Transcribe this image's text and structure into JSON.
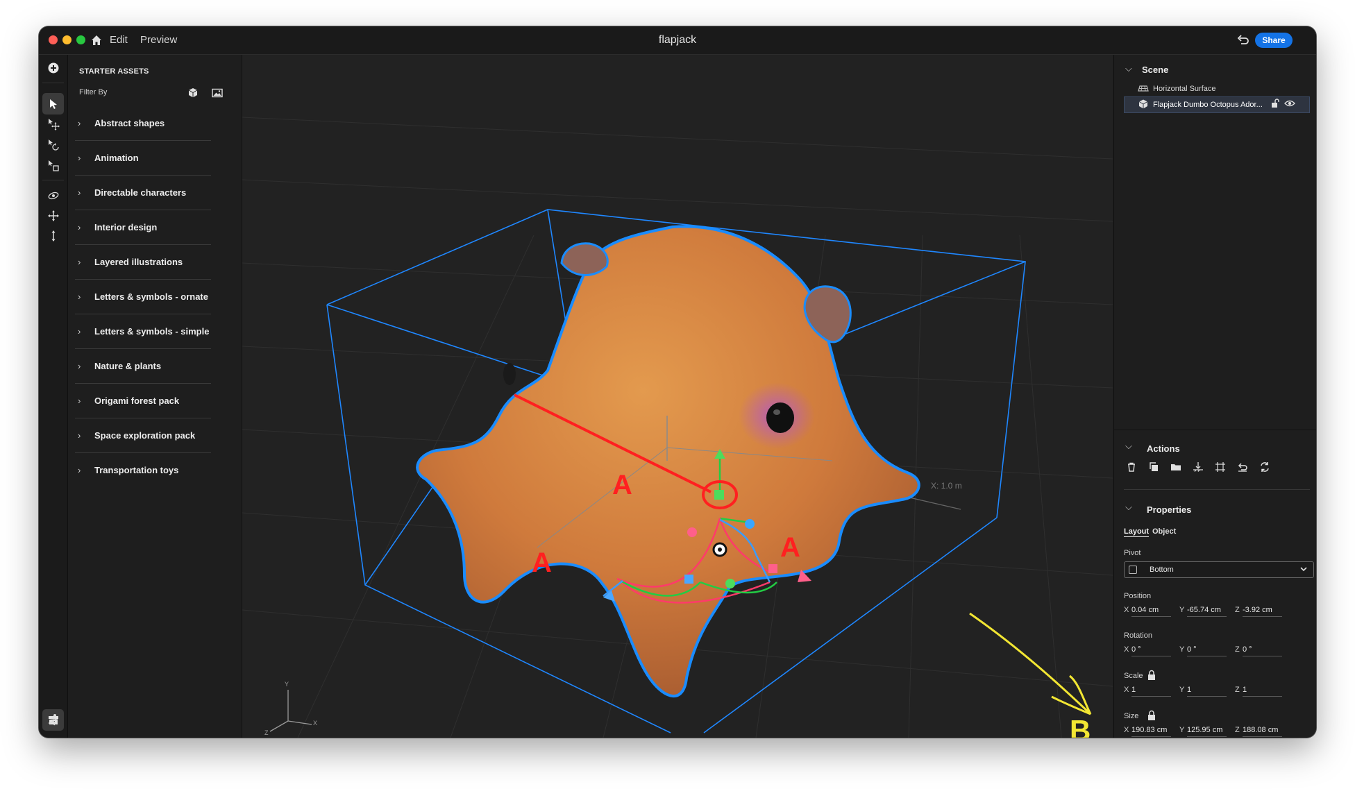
{
  "titlebar": {
    "menu_edit": "Edit",
    "menu_preview": "Preview",
    "doc_title": "flapjack",
    "share_label": "Share"
  },
  "assets": {
    "header": "STARTER ASSETS",
    "filter_label": "Filter By",
    "categories": [
      {
        "label": "Abstract shapes"
      },
      {
        "label": "Animation"
      },
      {
        "label": "Directable characters"
      },
      {
        "label": "Interior design"
      },
      {
        "label": "Layered illustrations"
      },
      {
        "label": "Letters & symbols - ornate"
      },
      {
        "label": "Letters & symbols - simple"
      },
      {
        "label": "Nature & plants"
      },
      {
        "label": "Origami forest pack"
      },
      {
        "label": "Space exploration pack"
      },
      {
        "label": "Transportation toys"
      }
    ]
  },
  "viewport": {
    "distance_label": "X: 1.0 m",
    "annotation_a": "A",
    "annotation_b": "B",
    "axis_x": "X",
    "axis_y": "Y",
    "axis_z": "Z",
    "colors": {
      "selection": "#1a8cff",
      "annotation_red": "#ff2020",
      "annotation_yellow": "#f2e633"
    }
  },
  "scene": {
    "title": "Scene",
    "items": [
      {
        "label": "Horizontal Surface"
      },
      {
        "label": "Flapjack Dumbo Octopus Ador..."
      }
    ]
  },
  "actions": {
    "title": "Actions"
  },
  "properties": {
    "title": "Properties",
    "tab_layout": "Layout",
    "tab_object": "Object",
    "pivot_label": "Pivot",
    "pivot_value": "Bottom",
    "position_label": "Position",
    "position": {
      "x": "0.04 cm",
      "y": "-65.74 cm",
      "z": "-3.92 cm"
    },
    "rotation_label": "Rotation",
    "rotation": {
      "x": "0 °",
      "y": "0 °",
      "z": "0 °"
    },
    "scale_label": "Scale",
    "scale": {
      "x": "1",
      "y": "1",
      "z": "1"
    },
    "size_label": "Size",
    "size": {
      "x": "190.83 cm",
      "y": "125.95 cm",
      "z": "188.08 cm"
    },
    "axis_x": "X",
    "axis_y": "Y",
    "axis_z": "Z"
  }
}
